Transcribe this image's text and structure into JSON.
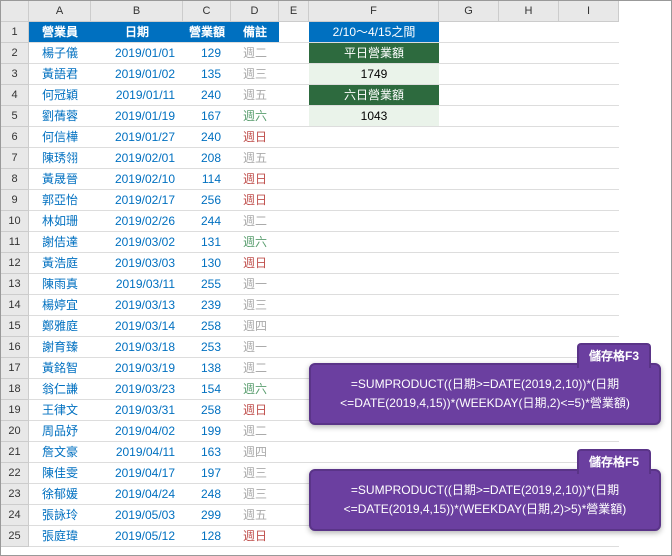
{
  "columns": [
    "",
    "A",
    "B",
    "C",
    "D",
    "E",
    "F",
    "G",
    "H",
    "I"
  ],
  "headers": {
    "a": "營業員",
    "b": "日期",
    "c": "營業額",
    "d": "備註"
  },
  "f": {
    "r1": "2/10～4/15之間",
    "r2": "平日營業額",
    "r3": "1749",
    "r4": "六日營業額",
    "r5": "1043"
  },
  "rows": [
    {
      "n": "1"
    },
    {
      "n": "2",
      "a": "楊子儀",
      "b": "2019/01/01",
      "c": "129",
      "d": "週二",
      "dc": "note"
    },
    {
      "n": "3",
      "a": "黃語君",
      "b": "2019/01/02",
      "c": "135",
      "d": "週三",
      "dc": "note"
    },
    {
      "n": "4",
      "a": "何冠穎",
      "b": "2019/01/11",
      "c": "240",
      "d": "週五",
      "dc": "note"
    },
    {
      "n": "5",
      "a": "劉蒨蓉",
      "b": "2019/01/19",
      "c": "167",
      "d": "週六",
      "dc": "note-sat"
    },
    {
      "n": "6",
      "a": "何信樺",
      "b": "2019/01/27",
      "c": "240",
      "d": "週日",
      "dc": "note-sun"
    },
    {
      "n": "7",
      "a": "陳琇翎",
      "b": "2019/02/01",
      "c": "208",
      "d": "週五",
      "dc": "note"
    },
    {
      "n": "8",
      "a": "黃晟晉",
      "b": "2019/02/10",
      "c": "114",
      "d": "週日",
      "dc": "note-sun"
    },
    {
      "n": "9",
      "a": "郭亞怡",
      "b": "2019/02/17",
      "c": "256",
      "d": "週日",
      "dc": "note-sun"
    },
    {
      "n": "10",
      "a": "林如珊",
      "b": "2019/02/26",
      "c": "244",
      "d": "週二",
      "dc": "note"
    },
    {
      "n": "11",
      "a": "謝佶達",
      "b": "2019/03/02",
      "c": "131",
      "d": "週六",
      "dc": "note-sat"
    },
    {
      "n": "12",
      "a": "黃浩庭",
      "b": "2019/03/03",
      "c": "130",
      "d": "週日",
      "dc": "note-sun"
    },
    {
      "n": "13",
      "a": "陳雨真",
      "b": "2019/03/11",
      "c": "255",
      "d": "週一",
      "dc": "note"
    },
    {
      "n": "14",
      "a": "楊婷宜",
      "b": "2019/03/13",
      "c": "239",
      "d": "週三",
      "dc": "note"
    },
    {
      "n": "15",
      "a": "鄭雅庭",
      "b": "2019/03/14",
      "c": "258",
      "d": "週四",
      "dc": "note"
    },
    {
      "n": "16",
      "a": "謝育臻",
      "b": "2019/03/18",
      "c": "253",
      "d": "週一",
      "dc": "note"
    },
    {
      "n": "17",
      "a": "黃銘智",
      "b": "2019/03/19",
      "c": "138",
      "d": "週二",
      "dc": "note"
    },
    {
      "n": "18",
      "a": "翁仁謙",
      "b": "2019/03/23",
      "c": "154",
      "d": "週六",
      "dc": "note-sat"
    },
    {
      "n": "19",
      "a": "王律文",
      "b": "2019/03/31",
      "c": "258",
      "d": "週日",
      "dc": "note-sun"
    },
    {
      "n": "20",
      "a": "周品妤",
      "b": "2019/04/02",
      "c": "199",
      "d": "週二",
      "dc": "note"
    },
    {
      "n": "21",
      "a": "詹文豪",
      "b": "2019/04/11",
      "c": "163",
      "d": "週四",
      "dc": "note"
    },
    {
      "n": "22",
      "a": "陳佳雯",
      "b": "2019/04/17",
      "c": "197",
      "d": "週三",
      "dc": "note"
    },
    {
      "n": "23",
      "a": "徐郁媛",
      "b": "2019/04/24",
      "c": "248",
      "d": "週三",
      "dc": "note"
    },
    {
      "n": "24",
      "a": "張詠玲",
      "b": "2019/05/03",
      "c": "299",
      "d": "週五",
      "dc": "note"
    },
    {
      "n": "25",
      "a": "張庭瑋",
      "b": "2019/05/12",
      "c": "128",
      "d": "週日",
      "dc": "note-sun"
    }
  ],
  "callouts": {
    "f3": {
      "label": "儲存格F3",
      "formula": "=SUMPRODUCT((日期>=DATE(2019,2,10))*(日期<=DATE(2019,4,15))*(WEEKDAY(日期,2)<=5)*營業額)"
    },
    "f5": {
      "label": "儲存格F5",
      "formula": "=SUMPRODUCT((日期>=DATE(2019,2,10))*(日期<=DATE(2019,4,15))*(WEEKDAY(日期,2)>5)*營業額)"
    }
  }
}
